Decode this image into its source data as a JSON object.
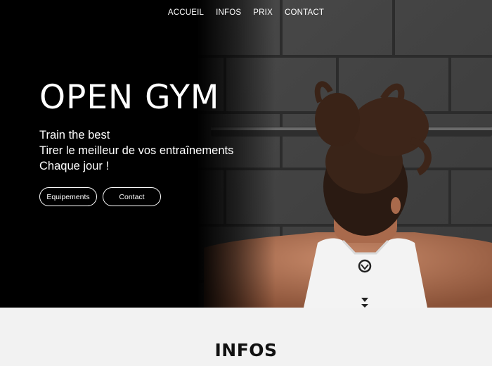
{
  "nav": {
    "items": [
      {
        "label": "ACCUEIL"
      },
      {
        "label": "INFOS"
      },
      {
        "label": "PRIX"
      },
      {
        "label": "CONTACT"
      }
    ]
  },
  "hero": {
    "title": "OPEN GYM",
    "lines": [
      "Train the best",
      "Tirer le meilleur de vos entraînements",
      "Chaque jour !"
    ],
    "buttons": {
      "equipements": "Equipements",
      "contact": "Contact"
    }
  },
  "infos": {
    "title": "INFOS"
  },
  "colors": {
    "hero_background": "#000000",
    "section_background": "#f2f2f2",
    "text_light": "#ffffff",
    "text_dark": "#111111"
  }
}
